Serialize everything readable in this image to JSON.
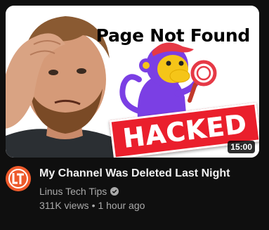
{
  "video": {
    "title": "My Channel Was Deleted Last Night",
    "duration": "15:00",
    "thumbnail_headline": "Page Not Found",
    "thumbnail_banner": "HACKED",
    "views": "311K views",
    "separator": "•",
    "age": "1 hour ago"
  },
  "channel": {
    "name": "Linus Tech Tips",
    "verified_icon": "verified-check-icon",
    "avatar_icon": "ltt-logo-icon"
  },
  "colors": {
    "background": "#0f0f0f",
    "title_text": "#f1f1f1",
    "secondary_text": "#aaaaaa",
    "banner_red": "#ea1f2c",
    "avatar_orange": "#ee5a2b",
    "monkey_purple": "#7b3fe4",
    "monkey_face": "#f5c518"
  }
}
